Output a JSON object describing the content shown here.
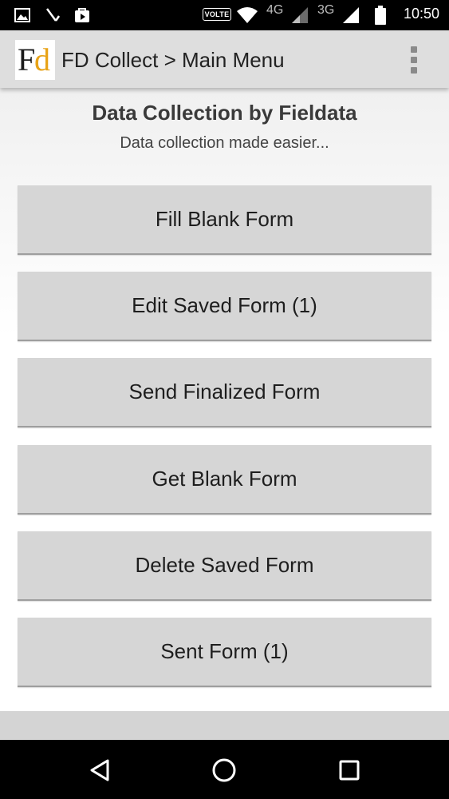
{
  "status_bar": {
    "network_badge": "VOLTE",
    "network_4g": "4G",
    "network_3g": "3G",
    "time": "10:50",
    "icons": [
      "image-icon",
      "missed-call-icon",
      "play-store-icon",
      "wifi-icon",
      "signal-icon",
      "signal-icon",
      "battery-icon"
    ]
  },
  "app_bar": {
    "logo_letter_f": "F",
    "logo_letter_d": "d",
    "title": "FD Collect > Main Menu",
    "overflow_icon": "overflow-menu-icon"
  },
  "main": {
    "heading": "Data Collection by Fieldata",
    "subheading": "Data collection made easier...",
    "buttons": [
      {
        "label": "Fill Blank Form"
      },
      {
        "label": "Edit Saved Form (1)"
      },
      {
        "label": "Send Finalized Form"
      },
      {
        "label": "Get Blank Form"
      },
      {
        "label": "Delete Saved Form"
      },
      {
        "label": "Sent Form (1)"
      }
    ]
  },
  "nav_bar": {
    "icons": [
      "back-icon",
      "home-icon",
      "recents-icon"
    ]
  },
  "colors": {
    "logo_accent": "#e8a317",
    "button_bg": "#d6d6d6",
    "app_bar_bg": "#dedede"
  }
}
